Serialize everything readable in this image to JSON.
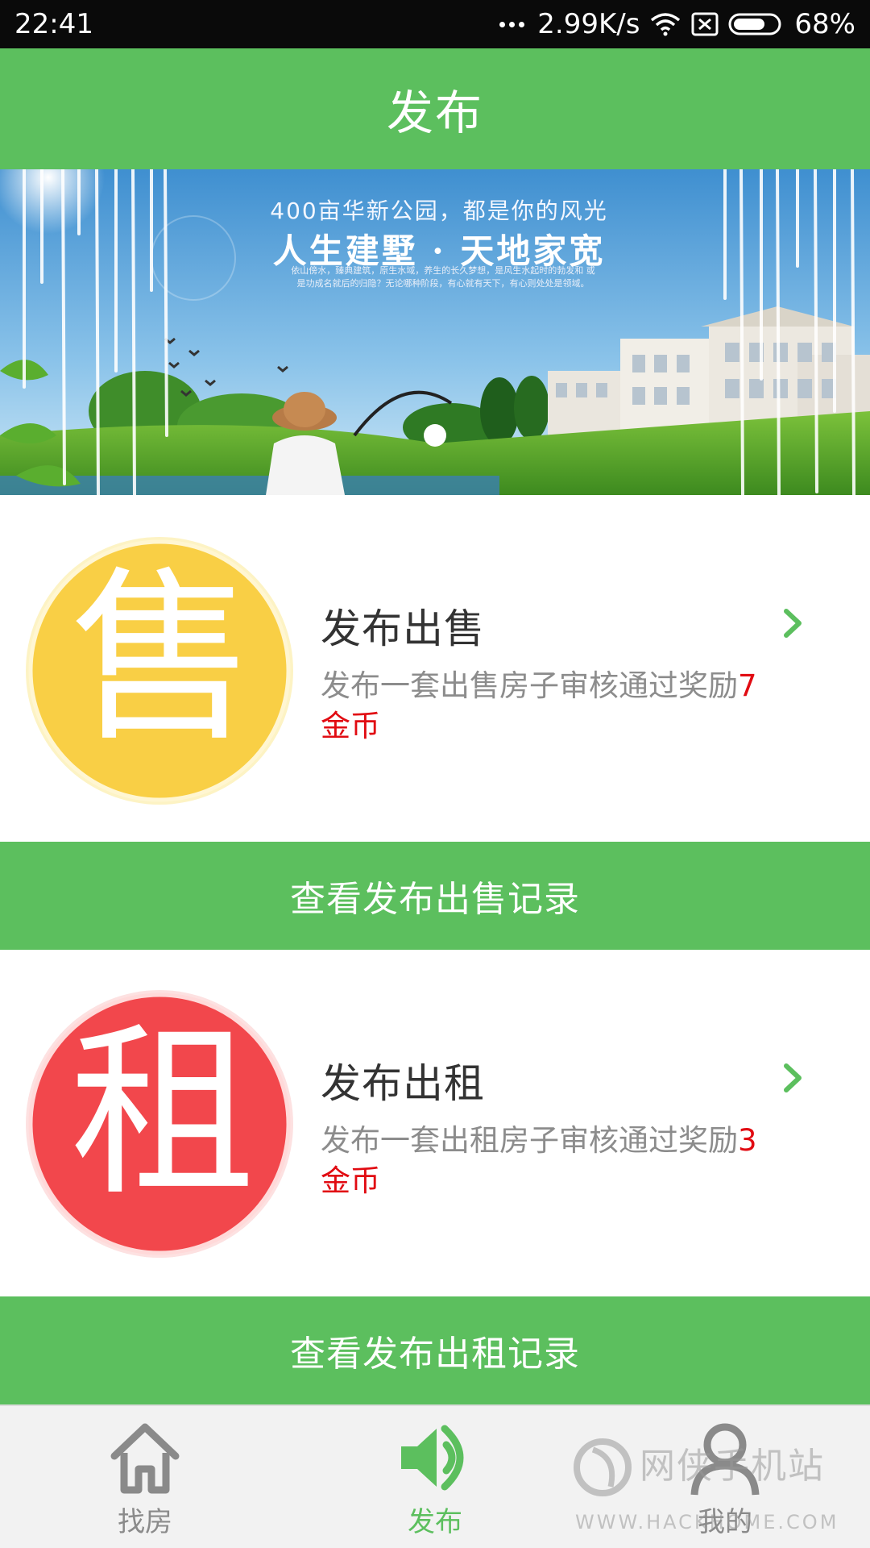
{
  "status_bar": {
    "time": "22:41",
    "network_speed": "2.99K/s",
    "battery": "68%",
    "icons": [
      "more-dots-icon",
      "wifi-icon",
      "sim-off-icon",
      "battery-icon"
    ]
  },
  "header": {
    "title": "发布"
  },
  "banner": {
    "line1": "400亩华新公园，都是你的风光",
    "line2": "人生建墅 · 天地家宽",
    "line3": "依山傍水，臻典建筑，原生水域，养生的长久梦想，是风生水起时的勃发和 或是功成名就后的归隐？无论哪种阶段，有心就有天下，有心则处处是领域。"
  },
  "sale_card": {
    "badge_char": "售",
    "title": "发布出售",
    "desc_prefix": "发布一套出售房子审核通过奖励",
    "reward": "7",
    "reward_unit": "金币",
    "badge_color": "#f9cf45"
  },
  "sale_records_button": "查看发布出售记录",
  "rent_card": {
    "badge_char": "租",
    "title": "发布出租",
    "desc_prefix": "发布一套出租房子审核通过奖励",
    "reward": "3",
    "reward_unit": "金币",
    "badge_color": "#f2474c"
  },
  "rent_records_button": "查看发布出租记录",
  "bottom_nav": {
    "items": [
      {
        "label": "找房",
        "icon": "home-icon",
        "active": false
      },
      {
        "label": "发布",
        "icon": "speaker-icon",
        "active": true
      },
      {
        "label": "我的",
        "icon": "user-icon",
        "active": false
      }
    ]
  },
  "watermark": {
    "text": "网侠手机站",
    "url": "WWW.HACKHOME.COM"
  },
  "colors": {
    "brand_green": "#5cbf5e",
    "reward_red": "#e10b12",
    "status_bar": "#0a0a0a"
  }
}
